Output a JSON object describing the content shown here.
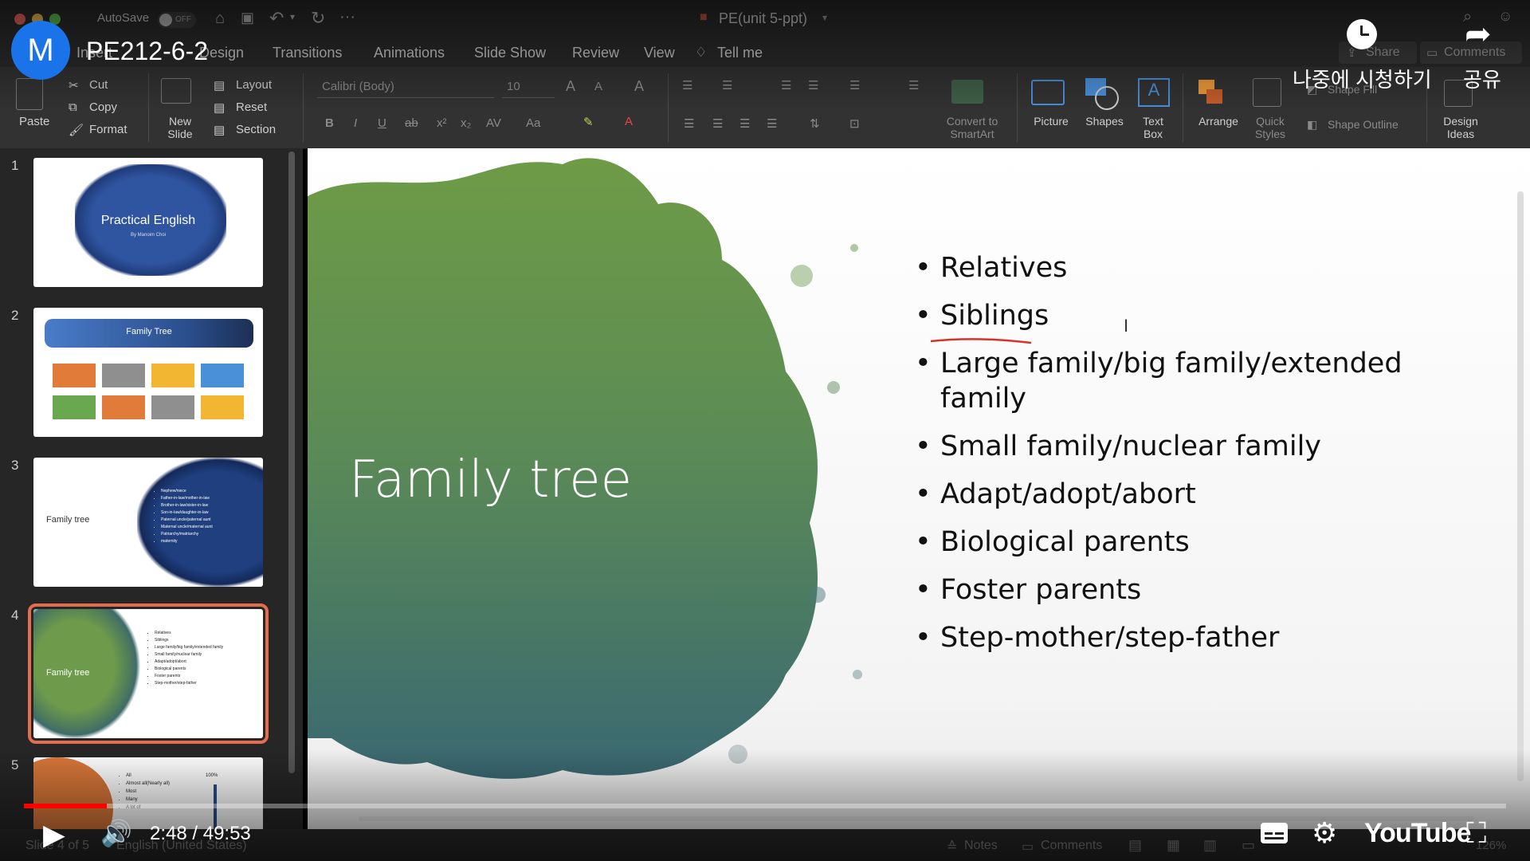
{
  "app": {
    "autosave_label": "AutoSave",
    "autosave_state": "OFF",
    "document_title": "PE(unit 5-ppt)",
    "tabs": [
      "Insert",
      "Design",
      "Transitions",
      "Animations",
      "Slide Show",
      "Review",
      "View",
      "Tell me"
    ],
    "share_label": "Share",
    "comments_label": "Comments"
  },
  "ribbon": {
    "paste": "Paste",
    "cut": "Cut",
    "copy": "Copy",
    "format": "Format",
    "new_slide": "New Slide",
    "layout": "Layout",
    "reset": "Reset",
    "section": "Section",
    "font_name": "Calibri (Body)",
    "font_size": "10",
    "convert_smartart": "Convert to SmartArt",
    "picture": "Picture",
    "shapes": "Shapes",
    "text_box": "Text Box",
    "arrange": "Arrange",
    "quick_styles": "Quick Styles",
    "shape_fill": "Shape Fill",
    "shape_outline": "Shape Outline",
    "design_ideas": "Design Ideas"
  },
  "thumbnails": [
    {
      "num": "1",
      "title": "Practical English",
      "subtitle": "By Manoim Choi"
    },
    {
      "num": "2",
      "title": "Family Tree"
    },
    {
      "num": "3",
      "title": "Family tree",
      "items": [
        "Nephew/niece",
        "Father-in-law/mother-in-law",
        "Brother-in-law/sister-in-law",
        "Son-in-law/daughter-in-law",
        "Paternal uncle/paternal aunt",
        "Maternal uncle/maternal aunt",
        "Patriarchy/matriarchy",
        "maternity"
      ]
    },
    {
      "num": "4",
      "title": "Family tree",
      "items": [
        "Relatives",
        "Siblings",
        "Large family/big family/extended family",
        "Small family/nuclear family",
        "Adapt/adopt/abort",
        "Biological parents",
        "Foster parents",
        "Step-mother/step-father"
      ]
    },
    {
      "num": "5",
      "items": [
        "All",
        "Almost all(Nearly all)",
        "Most",
        "Many",
        "A lot of"
      ],
      "label": "100%"
    }
  ],
  "slide": {
    "title": "Family tree",
    "bullets": [
      "Relatives",
      "Siblings",
      "Large family/big family/extended family",
      "Small family/nuclear family",
      "Adapt/adopt/abort",
      "Biological parents",
      "Foster parents",
      "Step-mother/step-father"
    ]
  },
  "status": {
    "slide_of": "Slide 4 of 5",
    "language": "English (United States)",
    "notes": "Notes",
    "comments": "Comments",
    "zoom": "126%"
  },
  "youtube": {
    "channel_initial": "M",
    "video_title": "PE212-6-2",
    "watch_later": "나중에 시청하기",
    "share": "공유",
    "time": "2:48 / 49:53",
    "progress_fraction": 0.056,
    "logo": "YouTube",
    "colors": {
      "progress": "#ff0000",
      "avatar": "#1a73e8"
    }
  }
}
